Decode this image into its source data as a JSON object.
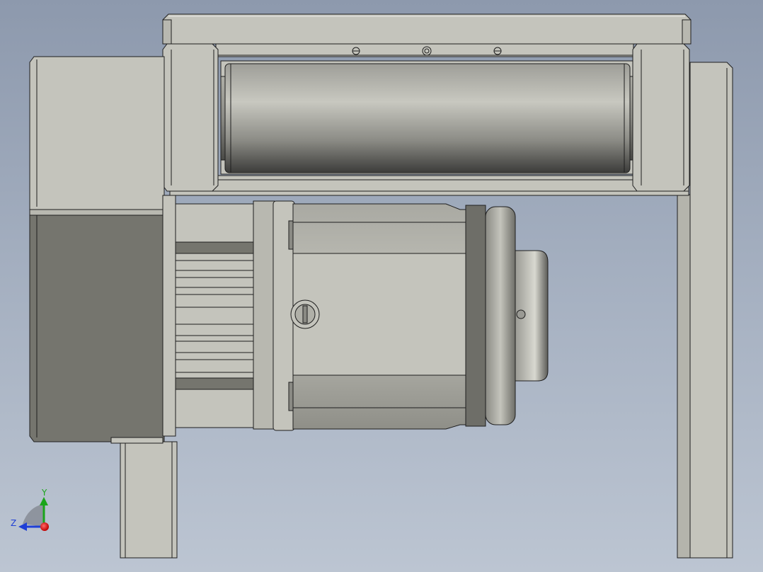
{
  "triad": {
    "y_label": "Y",
    "z_label": "Z",
    "y_color": "#1aa51a",
    "z_color": "#1f3fd6",
    "x_color": "#e01818"
  },
  "colors": {
    "background_top": "#8d99ad",
    "background_bottom": "#bcc5d2",
    "frame_light": "#c4c4bc",
    "frame_dark": "#75756e",
    "edge": "#1e1e1e"
  }
}
